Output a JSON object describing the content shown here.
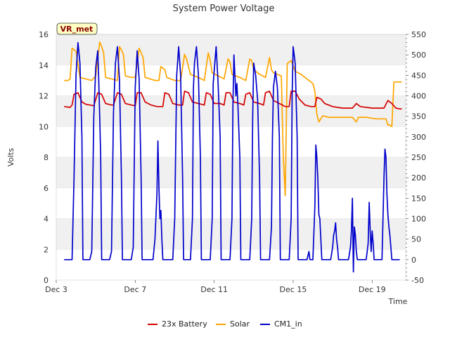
{
  "chart_data": {
    "type": "line",
    "title": "System Power Voltage",
    "xlabel": "Time",
    "ylabel": "Volts",
    "badge": "VR_met",
    "grid": "horizontal bands",
    "legend_placement": "bottom",
    "xlim": [
      3.0,
      20.7
    ],
    "ylim": [
      0,
      16
    ],
    "y2lim": [
      -50,
      550
    ],
    "x_ticks": [
      3,
      7,
      11,
      15,
      19
    ],
    "x_tick_labels": [
      "Dec 3",
      "Dec 7",
      "Dec 11",
      "Dec 15",
      "Dec 19"
    ],
    "y_ticks": [
      0,
      2,
      4,
      6,
      8,
      10,
      12,
      14,
      16
    ],
    "y2_ticks": [
      -50,
      0,
      50,
      100,
      150,
      200,
      250,
      300,
      350,
      400,
      450,
      500,
      550
    ],
    "series": [
      {
        "name": "23x Battery",
        "color": "#d40000",
        "axis": "left",
        "points": [
          [
            3.4,
            11.3
          ],
          [
            3.7,
            11.25
          ],
          [
            3.8,
            11.4
          ],
          [
            3.9,
            12.1
          ],
          [
            4.1,
            12.2
          ],
          [
            4.3,
            11.6
          ],
          [
            4.5,
            11.45
          ],
          [
            4.7,
            11.4
          ],
          [
            4.9,
            11.35
          ],
          [
            5.1,
            12.2
          ],
          [
            5.3,
            12.1
          ],
          [
            5.5,
            11.5
          ],
          [
            5.8,
            11.4
          ],
          [
            5.9,
            11.4
          ],
          [
            6.1,
            12.2
          ],
          [
            6.3,
            12.1
          ],
          [
            6.5,
            11.5
          ],
          [
            6.8,
            11.4
          ],
          [
            7.0,
            11.35
          ],
          [
            7.1,
            12.2
          ],
          [
            7.3,
            12.2
          ],
          [
            7.5,
            11.6
          ],
          [
            7.8,
            11.4
          ],
          [
            8.1,
            11.3
          ],
          [
            8.4,
            11.3
          ],
          [
            8.5,
            12.2
          ],
          [
            8.7,
            12.1
          ],
          [
            8.9,
            11.5
          ],
          [
            9.2,
            11.4
          ],
          [
            9.4,
            11.4
          ],
          [
            9.5,
            12.3
          ],
          [
            9.7,
            12.2
          ],
          [
            9.9,
            11.6
          ],
          [
            10.2,
            11.5
          ],
          [
            10.5,
            11.4
          ],
          [
            10.6,
            12.2
          ],
          [
            10.8,
            12.1
          ],
          [
            11.0,
            11.5
          ],
          [
            11.3,
            11.5
          ],
          [
            11.5,
            11.4
          ],
          [
            11.6,
            12.2
          ],
          [
            11.8,
            12.2
          ],
          [
            12.0,
            11.6
          ],
          [
            12.3,
            11.5
          ],
          [
            12.5,
            11.4
          ],
          [
            12.6,
            12.1
          ],
          [
            12.8,
            12.2
          ],
          [
            13.0,
            11.6
          ],
          [
            13.3,
            11.5
          ],
          [
            13.5,
            11.4
          ],
          [
            13.6,
            12.2
          ],
          [
            13.8,
            12.3
          ],
          [
            14.0,
            11.7
          ],
          [
            14.3,
            11.5
          ],
          [
            14.6,
            11.3
          ],
          [
            14.8,
            11.3
          ],
          [
            14.9,
            12.3
          ],
          [
            15.1,
            12.3
          ],
          [
            15.3,
            11.8
          ],
          [
            15.6,
            11.4
          ],
          [
            15.9,
            11.3
          ],
          [
            16.1,
            11.3
          ],
          [
            16.2,
            11.9
          ],
          [
            16.4,
            11.8
          ],
          [
            16.6,
            11.5
          ],
          [
            17.0,
            11.3
          ],
          [
            17.5,
            11.2
          ],
          [
            18.0,
            11.2
          ],
          [
            18.2,
            11.5
          ],
          [
            18.4,
            11.3
          ],
          [
            19.0,
            11.2
          ],
          [
            19.4,
            11.2
          ],
          [
            19.6,
            11.2
          ],
          [
            19.8,
            11.7
          ],
          [
            20.0,
            11.5
          ],
          [
            20.2,
            11.2
          ],
          [
            20.4,
            11.15
          ],
          [
            20.5,
            11.15
          ]
        ]
      },
      {
        "name": "Solar",
        "color": "#ffa500",
        "axis": "left",
        "points": [
          [
            3.4,
            13.0
          ],
          [
            3.6,
            13.0
          ],
          [
            3.7,
            13.1
          ],
          [
            3.8,
            15.1
          ],
          [
            4.0,
            14.9
          ],
          [
            4.2,
            13.2
          ],
          [
            4.5,
            13.1
          ],
          [
            4.8,
            13.0
          ],
          [
            5.0,
            13.3
          ],
          [
            5.2,
            15.5
          ],
          [
            5.3,
            15.2
          ],
          [
            5.4,
            14.8
          ],
          [
            5.5,
            13.2
          ],
          [
            5.8,
            13.1
          ],
          [
            6.1,
            13.0
          ],
          [
            6.2,
            15.2
          ],
          [
            6.3,
            15.0
          ],
          [
            6.4,
            14.7
          ],
          [
            6.5,
            13.3
          ],
          [
            6.8,
            13.2
          ],
          [
            7.0,
            13.2
          ],
          [
            7.2,
            15.1
          ],
          [
            7.4,
            14.5
          ],
          [
            7.5,
            13.2
          ],
          [
            8.0,
            13.0
          ],
          [
            8.2,
            13.0
          ],
          [
            8.3,
            13.9
          ],
          [
            8.5,
            13.7
          ],
          [
            8.6,
            13.2
          ],
          [
            9.0,
            13.0
          ],
          [
            9.3,
            13.0
          ],
          [
            9.5,
            14.7
          ],
          [
            9.6,
            14.4
          ],
          [
            9.8,
            13.4
          ],
          [
            10.2,
            13.2
          ],
          [
            10.5,
            13.0
          ],
          [
            10.7,
            14.8
          ],
          [
            10.8,
            14.3
          ],
          [
            10.9,
            13.5
          ],
          [
            11.2,
            13.3
          ],
          [
            11.5,
            13.1
          ],
          [
            11.7,
            14.4
          ],
          [
            11.8,
            14.2
          ],
          [
            11.9,
            13.4
          ],
          [
            12.3,
            13.2
          ],
          [
            12.6,
            13.0
          ],
          [
            12.8,
            14.4
          ],
          [
            12.9,
            14.3
          ],
          [
            13.0,
            13.7
          ],
          [
            13.3,
            13.4
          ],
          [
            13.6,
            13.2
          ],
          [
            13.8,
            14.5
          ],
          [
            13.9,
            13.7
          ],
          [
            14.0,
            13.5
          ],
          [
            14.4,
            13.3
          ],
          [
            14.5,
            8.0
          ],
          [
            14.6,
            5.5
          ],
          [
            14.7,
            14.1
          ],
          [
            14.9,
            14.3
          ],
          [
            15.1,
            13.6
          ],
          [
            15.4,
            13.4
          ],
          [
            15.6,
            13.2
          ],
          [
            15.8,
            13.0
          ],
          [
            16.0,
            12.8
          ],
          [
            16.1,
            12.3
          ],
          [
            16.2,
            10.8
          ],
          [
            16.3,
            10.3
          ],
          [
            16.5,
            10.7
          ],
          [
            16.8,
            10.6
          ],
          [
            17.2,
            10.6
          ],
          [
            17.6,
            10.6
          ],
          [
            18.0,
            10.6
          ],
          [
            18.2,
            10.3
          ],
          [
            18.3,
            10.6
          ],
          [
            18.7,
            10.6
          ],
          [
            19.2,
            10.5
          ],
          [
            19.5,
            10.5
          ],
          [
            19.7,
            10.5
          ],
          [
            19.8,
            10.1
          ],
          [
            19.9,
            10.1
          ],
          [
            20.0,
            10.0
          ],
          [
            20.1,
            12.9
          ],
          [
            20.5,
            12.9
          ]
        ]
      },
      {
        "name": "CM1_in",
        "color": "#0000cc",
        "axis": "right",
        "points": [
          [
            3.4,
            0
          ],
          [
            3.8,
            0
          ],
          [
            3.9,
            200
          ],
          [
            4.0,
            450
          ],
          [
            4.1,
            530
          ],
          [
            4.2,
            480
          ],
          [
            4.3,
            300
          ],
          [
            4.35,
            0
          ],
          [
            4.7,
            0
          ],
          [
            4.8,
            20
          ],
          [
            4.9,
            350
          ],
          [
            5.0,
            470
          ],
          [
            5.1,
            510
          ],
          [
            5.15,
            440
          ],
          [
            5.2,
            350
          ],
          [
            5.25,
            250
          ],
          [
            5.3,
            0
          ],
          [
            5.7,
            0
          ],
          [
            5.8,
            20
          ],
          [
            5.9,
            360
          ],
          [
            6.0,
            480
          ],
          [
            6.1,
            520
          ],
          [
            6.2,
            440
          ],
          [
            6.3,
            200
          ],
          [
            6.35,
            0
          ],
          [
            6.8,
            0
          ],
          [
            6.9,
            30
          ],
          [
            7.0,
            420
          ],
          [
            7.1,
            510
          ],
          [
            7.2,
            440
          ],
          [
            7.3,
            200
          ],
          [
            7.35,
            0
          ],
          [
            7.9,
            0
          ],
          [
            8.0,
            50
          ],
          [
            8.1,
            160
          ],
          [
            8.15,
            290
          ],
          [
            8.2,
            180
          ],
          [
            8.25,
            100
          ],
          [
            8.3,
            120
          ],
          [
            8.35,
            50
          ],
          [
            8.4,
            0
          ],
          [
            8.9,
            0
          ],
          [
            9.0,
            100
          ],
          [
            9.1,
            450
          ],
          [
            9.2,
            520
          ],
          [
            9.3,
            450
          ],
          [
            9.4,
            200
          ],
          [
            9.45,
            0
          ],
          [
            9.8,
            0
          ],
          [
            9.9,
            100
          ],
          [
            9.95,
            420
          ],
          [
            10.0,
            480
          ],
          [
            10.1,
            520
          ],
          [
            10.2,
            450
          ],
          [
            10.3,
            250
          ],
          [
            10.35,
            0
          ],
          [
            10.8,
            0
          ],
          [
            10.9,
            100
          ],
          [
            10.95,
            430
          ],
          [
            11.05,
            490
          ],
          [
            11.1,
            520
          ],
          [
            11.2,
            430
          ],
          [
            11.3,
            300
          ],
          [
            11.35,
            0
          ],
          [
            11.8,
            0
          ],
          [
            11.9,
            100
          ],
          [
            11.95,
            380
          ],
          [
            12.0,
            500
          ],
          [
            12.1,
            400
          ],
          [
            12.15,
            430
          ],
          [
            12.2,
            380
          ],
          [
            12.3,
            250
          ],
          [
            12.35,
            0
          ],
          [
            12.8,
            0
          ],
          [
            12.9,
            100
          ],
          [
            12.95,
            350
          ],
          [
            13.0,
            480
          ],
          [
            13.1,
            450
          ],
          [
            13.2,
            390
          ],
          [
            13.3,
            200
          ],
          [
            13.35,
            0
          ],
          [
            13.8,
            0
          ],
          [
            13.9,
            80
          ],
          [
            13.95,
            300
          ],
          [
            14.0,
            420
          ],
          [
            14.1,
            460
          ],
          [
            14.2,
            420
          ],
          [
            14.3,
            300
          ],
          [
            14.35,
            0
          ],
          [
            14.8,
            0
          ],
          [
            14.9,
            100
          ],
          [
            14.95,
            400
          ],
          [
            15.0,
            520
          ],
          [
            15.1,
            480
          ],
          [
            15.2,
            300
          ],
          [
            15.25,
            0
          ],
          [
            15.7,
            0
          ],
          [
            15.8,
            20
          ],
          [
            15.85,
            0
          ],
          [
            16.0,
            0
          ],
          [
            16.1,
            130
          ],
          [
            16.15,
            280
          ],
          [
            16.2,
            250
          ],
          [
            16.25,
            200
          ],
          [
            16.3,
            110
          ],
          [
            16.35,
            100
          ],
          [
            16.4,
            50
          ],
          [
            16.45,
            0
          ],
          [
            16.9,
            0
          ],
          [
            17.0,
            30
          ],
          [
            17.05,
            60
          ],
          [
            17.1,
            70
          ],
          [
            17.15,
            90
          ],
          [
            17.2,
            50
          ],
          [
            17.25,
            30
          ],
          [
            17.3,
            0
          ],
          [
            17.8,
            0
          ],
          [
            17.9,
            30
          ],
          [
            17.95,
            70
          ],
          [
            18.0,
            150
          ],
          [
            18.05,
            -30
          ],
          [
            18.1,
            80
          ],
          [
            18.15,
            60
          ],
          [
            18.2,
            20
          ],
          [
            18.25,
            0
          ],
          [
            18.7,
            0
          ],
          [
            18.8,
            40
          ],
          [
            18.85,
            140
          ],
          [
            18.9,
            70
          ],
          [
            18.95,
            20
          ],
          [
            19.0,
            70
          ],
          [
            19.05,
            40
          ],
          [
            19.1,
            0
          ],
          [
            19.5,
            0
          ],
          [
            19.6,
            200
          ],
          [
            19.65,
            270
          ],
          [
            19.7,
            250
          ],
          [
            19.75,
            160
          ],
          [
            19.8,
            110
          ],
          [
            19.85,
            80
          ],
          [
            19.9,
            60
          ],
          [
            19.95,
            30
          ],
          [
            20.0,
            0
          ],
          [
            20.4,
            0
          ]
        ]
      }
    ]
  }
}
